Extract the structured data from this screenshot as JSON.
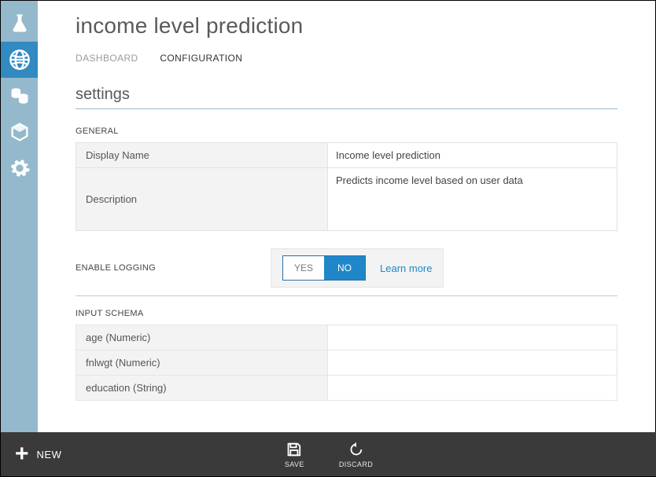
{
  "page_title": "income level prediction",
  "tabs": {
    "dashboard": "DASHBOARD",
    "configuration": "CONFIGURATION"
  },
  "section_title": "settings",
  "general": {
    "heading": "GENERAL",
    "display_name_label": "Display Name",
    "display_name_value": "Income level prediction",
    "description_label": "Description",
    "description_value": "Predicts income level based on user data"
  },
  "logging": {
    "label": "ENABLE LOGGING",
    "yes": "YES",
    "no": "NO",
    "selected": "NO",
    "learn_more": "Learn more"
  },
  "input_schema": {
    "heading": "INPUT SCHEMA",
    "rows": [
      "age (Numeric)",
      "fnlwgt (Numeric)",
      "education (String)"
    ]
  },
  "bottom": {
    "new": "NEW",
    "save": "SAVE",
    "discard": "DISCARD"
  }
}
